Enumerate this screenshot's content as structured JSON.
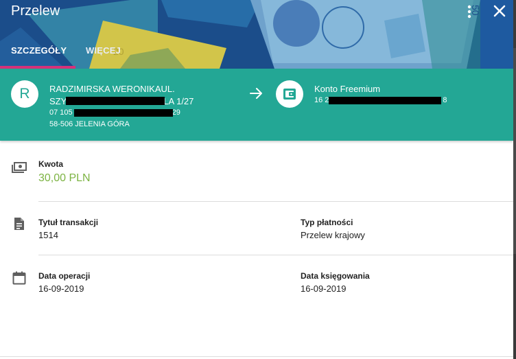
{
  "header": {
    "title": "Przelew",
    "menu_icon": "more-vert-icon",
    "close_icon": "close-icon"
  },
  "tabs": [
    {
      "label": "SZCZEGÓŁY",
      "active": true
    },
    {
      "label": "WIĘCEJ",
      "active": false
    }
  ],
  "sender": {
    "initial": "R",
    "name": "RADZIMIRSKA WERONIKAUL.",
    "street_start": "SZY",
    "street_end": "LA 1/27",
    "account_start": "07 105",
    "account_end": "29",
    "city": "58-506 JELENIA GÓRA"
  },
  "recipient": {
    "account_name": "Konto Freemium",
    "account_start": "16 2",
    "account_end": "8"
  },
  "amount": {
    "label": "Kwota",
    "value": "30,00 PLN"
  },
  "details": {
    "title_label": "Tytuł transakcji",
    "title_value": "1514",
    "payment_type_label": "Typ płatności",
    "payment_type_value": "Przelew krajowy"
  },
  "dates": {
    "operation_label": "Data operacji",
    "operation_value": "16-09-2019",
    "booking_label": "Data księgowania",
    "booking_value": "16-09-2019"
  },
  "colors": {
    "header": "#1b4d8a",
    "band": "#23a795",
    "tab_indicator": "#d6317a",
    "amount": "#7cb342"
  }
}
